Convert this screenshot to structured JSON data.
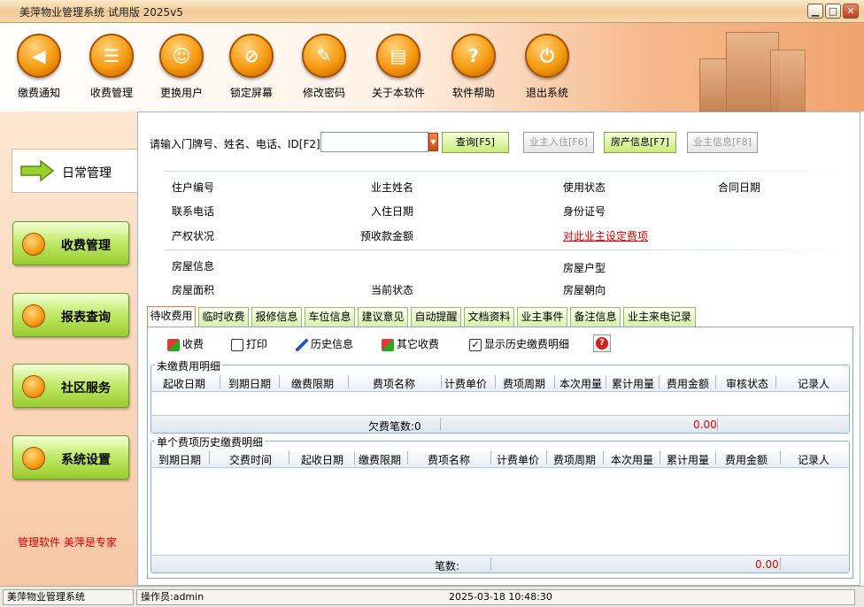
{
  "window": {
    "title": "美萍物业管理系统 试用版 2025v5"
  },
  "toolbar": [
    {
      "label": "缴费通知",
      "icon": "notice-icon"
    },
    {
      "label": "收费管理",
      "icon": "billing-icon"
    },
    {
      "label": "更换用户",
      "icon": "switch-user-icon"
    },
    {
      "label": "锁定屏幕",
      "icon": "lock-screen-icon"
    },
    {
      "label": "修改密码",
      "icon": "wrench-icon"
    },
    {
      "label": "关于本软件",
      "icon": "about-icon"
    },
    {
      "label": "软件帮助",
      "icon": "help-icon"
    },
    {
      "label": "退出系统",
      "icon": "power-icon"
    }
  ],
  "sidebar": {
    "active": "日常管理",
    "items": [
      "收费管理",
      "报表查询",
      "社区服务",
      "系统设置"
    ],
    "slogan": "管理软件 美萍是专家"
  },
  "search": {
    "prompt": "请输入门牌号、姓名、电话、ID[F2]",
    "value": "",
    "query_btn": "查询[F5]",
    "checkin_btn": "业主入住[F6]",
    "house_btn": "房产信息[F7]",
    "owner_btn": "业主信息[F8]"
  },
  "info": {
    "unit_no": "住户编号",
    "owner_name": "业主姓名",
    "usage": "使用状态",
    "contract_date": "合同日期",
    "phone": "联系电话",
    "checkin_date": "入住日期",
    "id_no": "身份证号",
    "property_status": "产权状况",
    "prepaid": "预收款金额",
    "set_fee_link": "对此业主设定费项",
    "house_info": "房屋信息",
    "house_type": "房屋户型",
    "house_area": "房屋面积",
    "current_status": "当前状态",
    "orientation": "房屋朝向"
  },
  "tabs": [
    "待收费用",
    "临时收费",
    "报修信息",
    "车位信息",
    "建议意见",
    "自动提醒",
    "文档资料",
    "业主事件",
    "备注信息",
    "业主来电记录"
  ],
  "actions": {
    "collect": "收费",
    "print": "打印",
    "history": "历史信息",
    "other": "其它收费",
    "show_history": "显示历史缴费明细",
    "show_history_checked": true
  },
  "unpaid": {
    "title": "未缴费用明细",
    "columns": [
      "起收日期",
      "到期日期",
      "缴费限期",
      "费项名称",
      "计费单价",
      "费项周期",
      "本次用量",
      "累计用量",
      "费用金额",
      "审核状态",
      "记录人"
    ],
    "summary_label": "欠费笔数:0",
    "summary_amount": "0.00"
  },
  "history": {
    "title": "单个费项历史缴费明细",
    "columns": [
      "到期日期",
      "交费时间",
      "起收日期",
      "缴费限期",
      "费项名称",
      "计费单价",
      "费项周期",
      "本次用量",
      "累计用量",
      "费用金额",
      "记录人"
    ],
    "summary_label": "笔数:",
    "summary_amount": "0.00"
  },
  "statusbar": {
    "app": "美萍物业管理系统",
    "operator": "操作员:admin",
    "datetime": "2025-03-18 10:48:30"
  },
  "colors": {
    "accent_orange": "#f59a10",
    "green_button": "#99cc2e",
    "link_red": "#e00000"
  }
}
